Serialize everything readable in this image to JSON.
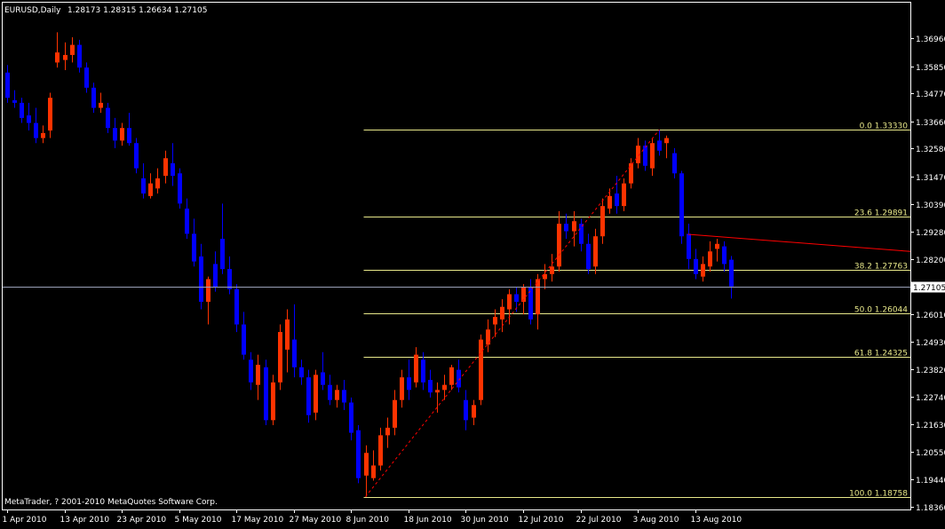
{
  "header": {
    "symbol": "EURUSD,Daily",
    "ohlc": "1.28173 1.28315 1.26634 1.27105"
  },
  "copyright": "MetaTrader, ? 2001-2010 MetaQuotes Software Corp.",
  "colors": {
    "background": "#000000",
    "frame": "#ffffff",
    "bull": "#ff3300",
    "bear": "#0000ff",
    "text": "#ffffff",
    "fib": "#e8e88a",
    "fib_text": "#e8e88a",
    "trend": "#ff0000",
    "bid": "#9aa0b8"
  },
  "chart_data": {
    "type": "candlestick",
    "y_axis": {
      "range": [
        1.1836,
        1.3746
      ],
      "ticks": [
        "1.36960",
        "1.35850",
        "1.34770",
        "1.33660",
        "1.32580",
        "1.31470",
        "1.30390",
        "1.29280",
        "1.28200",
        "1.27105",
        "1.26010",
        "1.24930",
        "1.23820",
        "1.22740",
        "1.21630",
        "1.20550",
        "1.19440",
        "1.18360"
      ]
    },
    "x_axis": {
      "labels": [
        {
          "label": "1 Apr 2010",
          "index": 0
        },
        {
          "label": "13 Apr 2010",
          "index": 8
        },
        {
          "label": "23 Apr 2010",
          "index": 16
        },
        {
          "label": "5 May 2010",
          "index": 24
        },
        {
          "label": "17 May 2010",
          "index": 32
        },
        {
          "label": "27 May 2010",
          "index": 40
        },
        {
          "label": "8 Jun 2010",
          "index": 48
        },
        {
          "label": "18 Jun 2010",
          "index": 56
        },
        {
          "label": "30 Jun 2010",
          "index": 64
        },
        {
          "label": "12 Jul 2010",
          "index": 72
        },
        {
          "label": "22 Jul 2010",
          "index": 80
        },
        {
          "label": "3 Aug 2010",
          "index": 88
        },
        {
          "label": "13 Aug 2010",
          "index": 96
        }
      ]
    },
    "candles": [
      [
        1.356,
        1.359,
        1.344,
        1.346
      ],
      [
        1.345,
        1.349,
        1.342,
        1.344
      ],
      [
        1.344,
        1.346,
        1.336,
        1.338
      ],
      [
        1.339,
        1.344,
        1.333,
        1.336
      ],
      [
        1.336,
        1.342,
        1.328,
        1.33
      ],
      [
        1.33,
        1.335,
        1.328,
        1.332
      ],
      [
        1.333,
        1.348,
        1.33,
        1.346
      ],
      [
        1.36,
        1.372,
        1.358,
        1.364
      ],
      [
        1.361,
        1.368,
        1.357,
        1.363
      ],
      [
        1.363,
        1.37,
        1.36,
        1.367
      ],
      [
        1.367,
        1.369,
        1.356,
        1.358
      ],
      [
        1.358,
        1.36,
        1.348,
        1.35
      ],
      [
        1.35,
        1.352,
        1.34,
        1.342
      ],
      [
        1.342,
        1.348,
        1.34,
        1.344
      ],
      [
        1.342,
        1.344,
        1.332,
        1.334
      ],
      [
        1.334,
        1.338,
        1.326,
        1.329
      ],
      [
        1.329,
        1.336,
        1.327,
        1.334
      ],
      [
        1.334,
        1.34,
        1.327,
        1.328
      ],
      [
        1.328,
        1.33,
        1.316,
        1.318
      ],
      [
        1.314,
        1.32,
        1.306,
        1.308
      ],
      [
        1.307,
        1.316,
        1.306,
        1.312
      ],
      [
        1.31,
        1.318,
        1.308,
        1.314
      ],
      [
        1.315,
        1.325,
        1.312,
        1.322
      ],
      [
        1.32,
        1.328,
        1.311,
        1.315
      ],
      [
        1.316,
        1.318,
        1.302,
        1.304
      ],
      [
        1.302,
        1.306,
        1.29,
        1.292
      ],
      [
        1.292,
        1.298,
        1.279,
        1.281
      ],
      [
        1.283,
        1.288,
        1.262,
        1.265
      ],
      [
        1.265,
        1.275,
        1.256,
        1.274
      ],
      [
        1.28,
        1.285,
        1.269,
        1.271
      ],
      [
        1.29,
        1.304,
        1.276,
        1.278
      ],
      [
        1.278,
        1.283,
        1.268,
        1.27
      ],
      [
        1.27,
        1.272,
        1.253,
        1.256
      ],
      [
        1.256,
        1.261,
        1.242,
        1.244
      ],
      [
        1.242,
        1.245,
        1.23,
        1.233
      ],
      [
        1.232,
        1.244,
        1.226,
        1.24
      ],
      [
        1.239,
        1.242,
        1.216,
        1.218
      ],
      [
        1.218,
        1.236,
        1.216,
        1.233
      ],
      [
        1.233,
        1.256,
        1.23,
        1.253
      ],
      [
        1.246,
        1.262,
        1.237,
        1.258
      ],
      [
        1.25,
        1.264,
        1.235,
        1.239
      ],
      [
        1.239,
        1.242,
        1.232,
        1.235
      ],
      [
        1.235,
        1.238,
        1.217,
        1.22
      ],
      [
        1.221,
        1.238,
        1.218,
        1.236
      ],
      [
        1.237,
        1.245,
        1.23,
        1.232
      ],
      [
        1.232,
        1.236,
        1.224,
        1.226
      ],
      [
        1.226,
        1.232,
        1.223,
        1.23
      ],
      [
        1.23,
        1.234,
        1.222,
        1.225
      ],
      [
        1.225,
        1.227,
        1.21,
        1.213
      ],
      [
        1.214,
        1.216,
        1.193,
        1.195
      ],
      [
        1.196,
        1.208,
        1.1876,
        1.205
      ],
      [
        1.195,
        1.206,
        1.194,
        1.2
      ],
      [
        1.2,
        1.215,
        1.198,
        1.212
      ],
      [
        1.212,
        1.219,
        1.207,
        1.215
      ],
      [
        1.215,
        1.23,
        1.212,
        1.226
      ],
      [
        1.226,
        1.238,
        1.223,
        1.235
      ],
      [
        1.235,
        1.242,
        1.226,
        1.23
      ],
      [
        1.233,
        1.247,
        1.231,
        1.244
      ],
      [
        1.242,
        1.245,
        1.23,
        1.233
      ],
      [
        1.234,
        1.238,
        1.227,
        1.229
      ],
      [
        1.229,
        1.233,
        1.221,
        1.23
      ],
      [
        1.23,
        1.236,
        1.226,
        1.232
      ],
      [
        1.232,
        1.24,
        1.23,
        1.239
      ],
      [
        1.238,
        1.242,
        1.229,
        1.231
      ],
      [
        1.226,
        1.23,
        1.214,
        1.218
      ],
      [
        1.219,
        1.226,
        1.216,
        1.224
      ],
      [
        1.226,
        1.252,
        1.224,
        1.25
      ],
      [
        1.248,
        1.258,
        1.245,
        1.254
      ],
      [
        1.256,
        1.262,
        1.251,
        1.259
      ],
      [
        1.258,
        1.266,
        1.253,
        1.263
      ],
      [
        1.262,
        1.27,
        1.256,
        1.268
      ],
      [
        1.268,
        1.271,
        1.261,
        1.265
      ],
      [
        1.265,
        1.272,
        1.26,
        1.271
      ],
      [
        1.271,
        1.274,
        1.256,
        1.258
      ],
      [
        1.26,
        1.276,
        1.254,
        1.274
      ],
      [
        1.274,
        1.28,
        1.27,
        1.276
      ],
      [
        1.276,
        1.284,
        1.273,
        1.279
      ],
      [
        1.279,
        1.301,
        1.277,
        1.296
      ],
      [
        1.296,
        1.3,
        1.29,
        1.293
      ],
      [
        1.293,
        1.301,
        1.287,
        1.297
      ],
      [
        1.296,
        1.298,
        1.285,
        1.288
      ],
      [
        1.288,
        1.292,
        1.276,
        1.278
      ],
      [
        1.279,
        1.294,
        1.276,
        1.291
      ],
      [
        1.291,
        1.306,
        1.288,
        1.303
      ],
      [
        1.302,
        1.31,
        1.3,
        1.307
      ],
      [
        1.308,
        1.315,
        1.3,
        1.303
      ],
      [
        1.303,
        1.314,
        1.301,
        1.312
      ],
      [
        1.312,
        1.322,
        1.31,
        1.32
      ],
      [
        1.32,
        1.33,
        1.318,
        1.327
      ],
      [
        1.327,
        1.329,
        1.317,
        1.319
      ],
      [
        1.318,
        1.33,
        1.315,
        1.328
      ],
      [
        1.329,
        1.3333,
        1.323,
        1.325
      ],
      [
        1.328,
        1.331,
        1.322,
        1.33
      ],
      [
        1.324,
        1.326,
        1.314,
        1.316
      ],
      [
        1.316,
        1.317,
        1.288,
        1.291
      ],
      [
        1.292,
        1.296,
        1.278,
        1.282
      ],
      [
        1.282,
        1.286,
        1.274,
        1.276
      ],
      [
        1.275,
        1.283,
        1.273,
        1.28
      ],
      [
        1.279,
        1.289,
        1.277,
        1.285
      ],
      [
        1.286,
        1.29,
        1.281,
        1.288
      ],
      [
        1.287,
        1.289,
        1.277,
        1.28
      ],
      [
        1.2817,
        1.2832,
        1.2663,
        1.2711
      ]
    ],
    "fibonacci": [
      {
        "level": "0.0",
        "price": 1.3333,
        "label": "1.33330"
      },
      {
        "level": "23.6",
        "price": 1.29891,
        "label": "1.29891"
      },
      {
        "level": "38.2",
        "price": 1.27763,
        "label": "1.27763"
      },
      {
        "level": "50.0",
        "price": 1.26044,
        "label": "1.26044"
      },
      {
        "level": "61.8",
        "price": 1.24325,
        "label": "1.24325"
      },
      {
        "level": "100.0",
        "price": 1.18758,
        "label": "1.18758"
      }
    ],
    "fib_start_index": 50,
    "fib_diagonal": {
      "from": [
        50,
        1.1876
      ],
      "to": [
        91,
        1.3333
      ]
    },
    "trendline": {
      "from": [
        95,
        1.2918
      ],
      "to": [
        126,
        1.285
      ]
    },
    "bid": {
      "price": 1.27105,
      "label": "1.27105"
    }
  }
}
